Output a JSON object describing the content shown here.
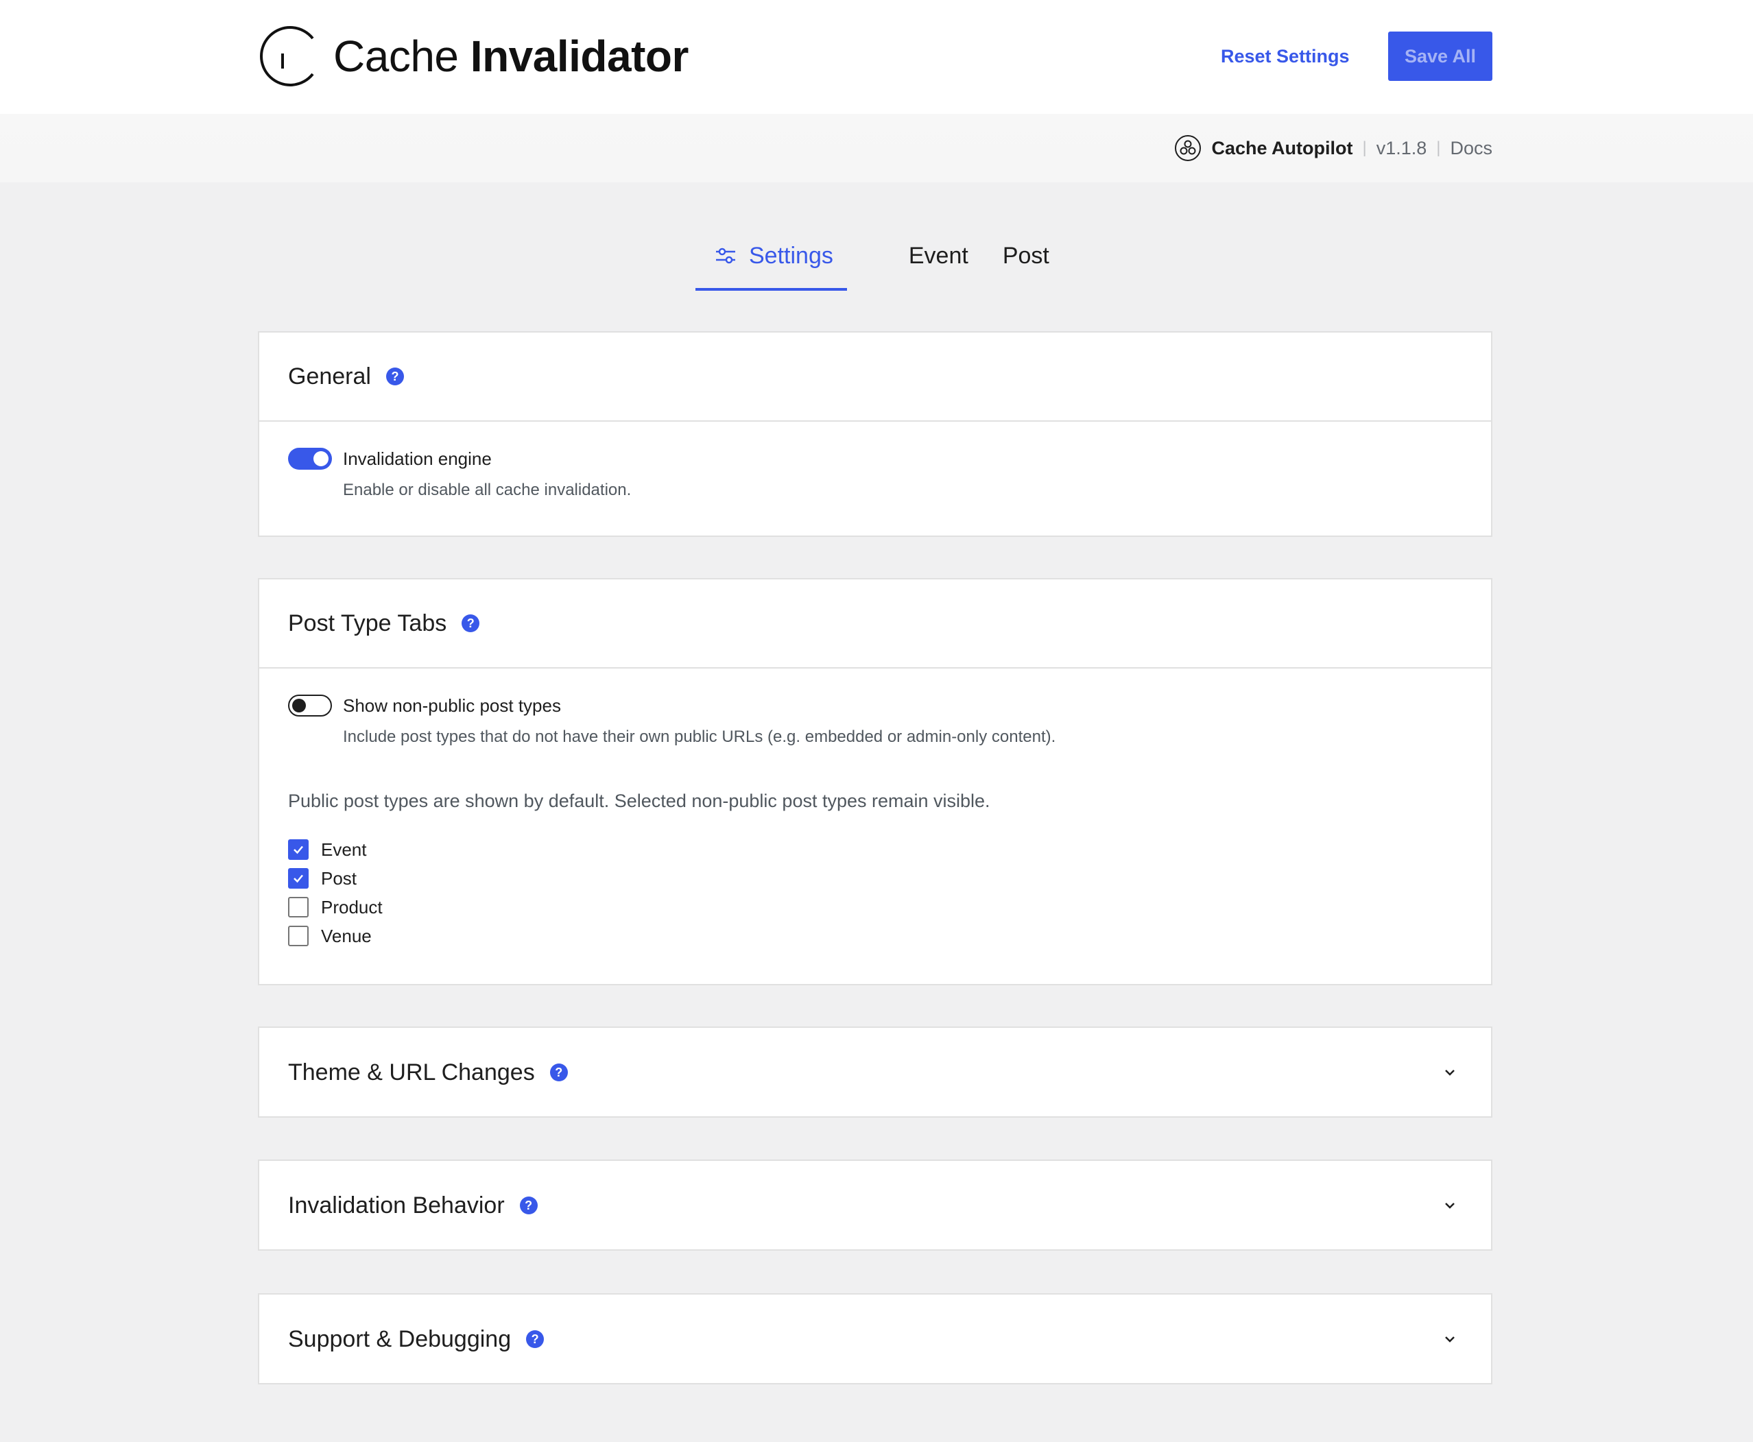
{
  "header": {
    "title_light": "Cache ",
    "title_bold": "Invalidator",
    "reset_label": "Reset Settings",
    "save_label": "Save All"
  },
  "subbar": {
    "product": "Cache Autopilot",
    "version": "v1.1.8",
    "docs": "Docs",
    "icon": "cache-autopilot-logo-icon"
  },
  "tabs": [
    {
      "label": "Settings",
      "icon": "sliders-icon",
      "active": true
    },
    {
      "label": "Event",
      "active": false
    },
    {
      "label": "Post",
      "active": false
    }
  ],
  "general": {
    "title": "General",
    "help": "?",
    "engine_label": "Invalidation engine",
    "engine_help": "Enable or disable all cache invalidation.",
    "engine_enabled": true
  },
  "post_type_tabs": {
    "title": "Post Type Tabs",
    "help": "?",
    "nonpublic_label": "Show non-public post types",
    "nonpublic_help": "Include post types that do not have their own public URLs (e.g. embedded or admin-only content).",
    "nonpublic_enabled": false,
    "info": "Public post types are shown by default. Selected non-public post types remain visible.",
    "types": [
      {
        "label": "Event",
        "checked": true
      },
      {
        "label": "Post",
        "checked": true
      },
      {
        "label": "Product",
        "checked": false
      },
      {
        "label": "Venue",
        "checked": false
      }
    ]
  },
  "collapsed_sections": [
    {
      "title": "Theme & URL Changes",
      "help": "?"
    },
    {
      "title": "Invalidation Behavior",
      "help": "?"
    },
    {
      "title": "Support & Debugging",
      "help": "?"
    }
  ],
  "colors": {
    "accent": "#3858e9",
    "background": "#f0f0f1",
    "panel_border": "#e0e0e0"
  }
}
